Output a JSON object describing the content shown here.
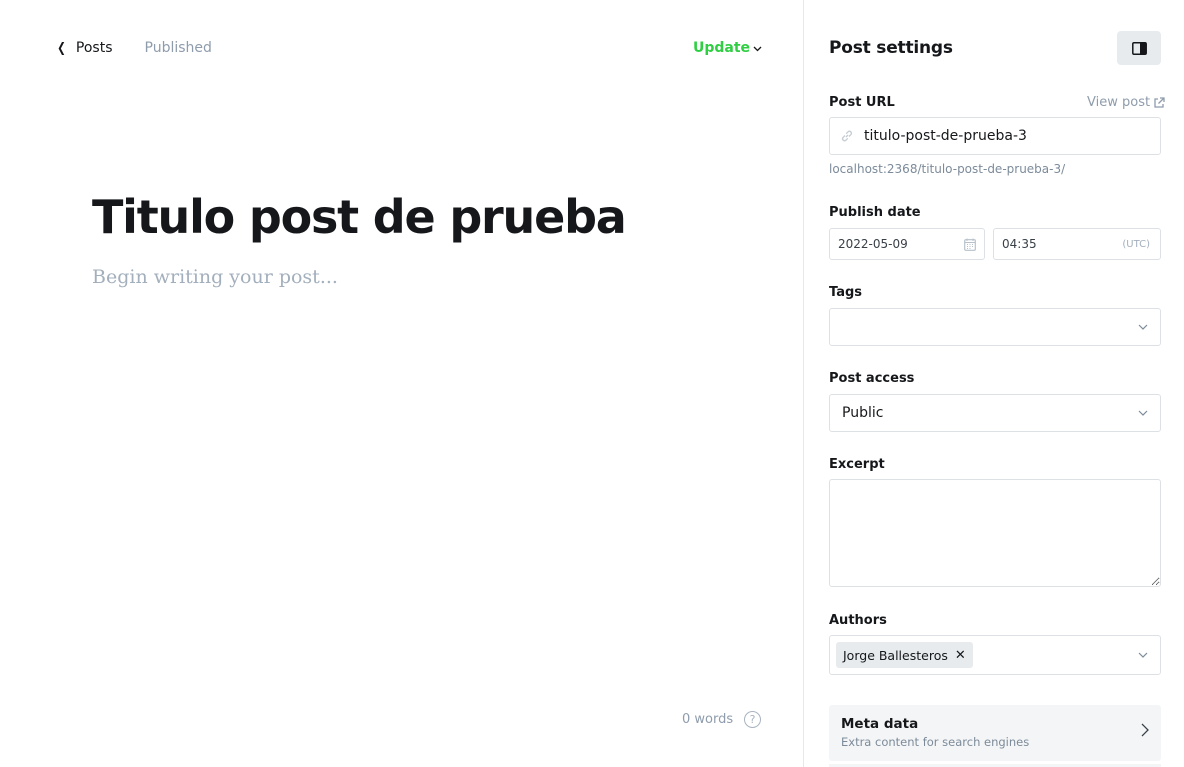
{
  "editor": {
    "back_label": "Posts",
    "status": "Published",
    "update_label": "Update",
    "title": "Titulo post de prueba",
    "body_placeholder": "Begin writing your post...",
    "word_count": "0 words",
    "help_label": "?"
  },
  "settings": {
    "title": "Post settings",
    "post_url": {
      "label": "Post URL",
      "view_post_label": "View post",
      "value": "titulo-post-de-prueba-3",
      "hint": "localhost:2368/titulo-post-de-prueba-3/"
    },
    "publish_date": {
      "label": "Publish date",
      "date": "2022-05-09",
      "time": "04:35",
      "timezone": "(UTC)"
    },
    "tags": {
      "label": "Tags"
    },
    "post_access": {
      "label": "Post access",
      "value": "Public"
    },
    "excerpt": {
      "label": "Excerpt",
      "value": ""
    },
    "authors": {
      "label": "Authors",
      "items": [
        "Jorge Ballesteros"
      ]
    },
    "meta_data": {
      "title": "Meta data",
      "description": "Extra content for search engines"
    }
  },
  "colors": {
    "accent_green": "#30cf43",
    "text_dark": "#15171a",
    "text_muted": "#8e9cac",
    "border": "#dde1e5"
  },
  "icons": [
    "chevron-left-icon",
    "chevron-down-icon",
    "sidebar-toggle-icon",
    "external-link-icon",
    "link-icon",
    "calendar-icon",
    "close-icon",
    "chevron-right-icon",
    "help-icon"
  ]
}
